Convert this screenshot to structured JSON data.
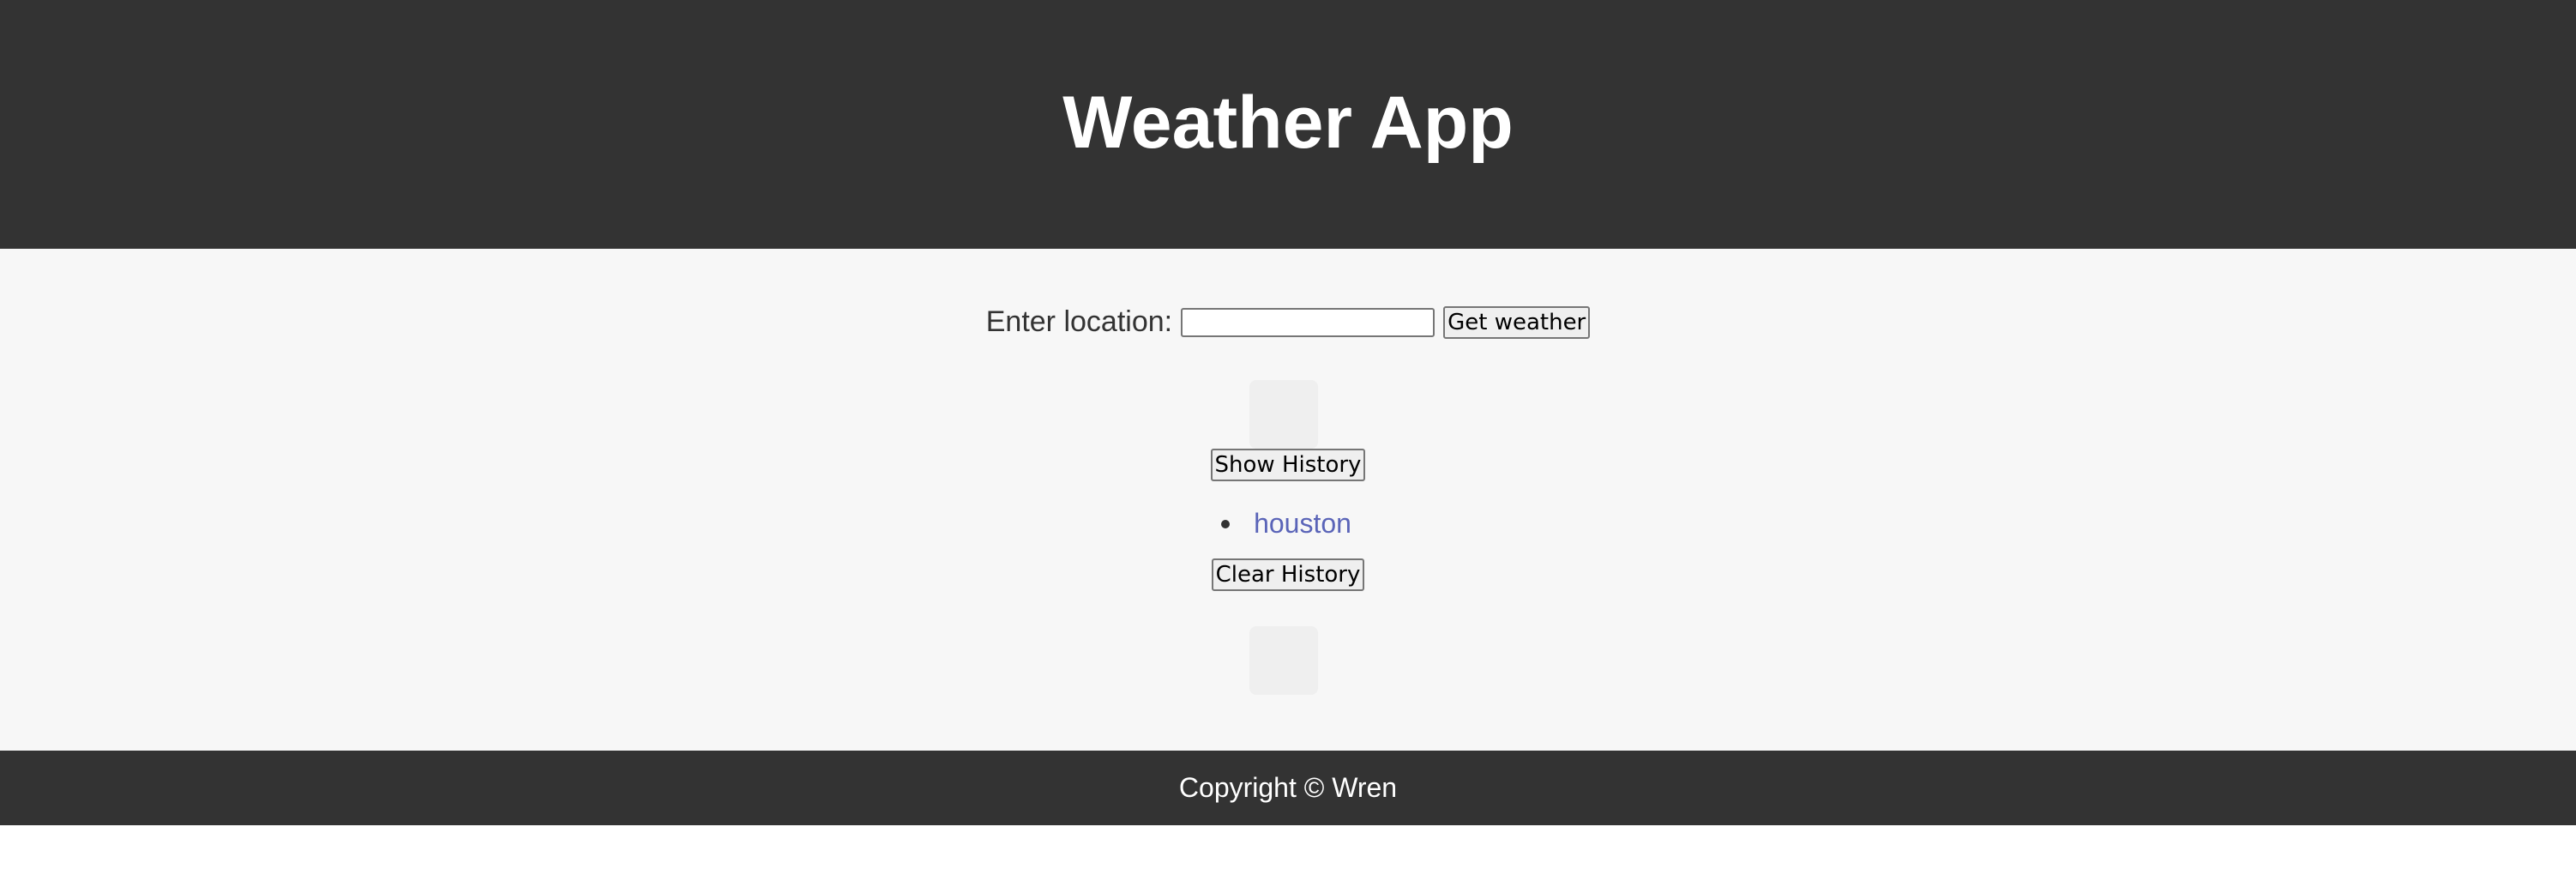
{
  "header": {
    "title": "Weather App"
  },
  "search": {
    "label": "Enter location:",
    "value": "",
    "placeholder": "",
    "submit_label": "Get weather"
  },
  "history": {
    "show_label": "Show History",
    "items": [
      {
        "label": "houston"
      }
    ],
    "clear_label": "Clear History"
  },
  "footer": {
    "copyright": "Copyright © Wren"
  },
  "colors": {
    "header_bg": "#333333",
    "main_bg": "#f7f7f7",
    "link": "#5a64b8",
    "footer_bg": "#333333"
  }
}
